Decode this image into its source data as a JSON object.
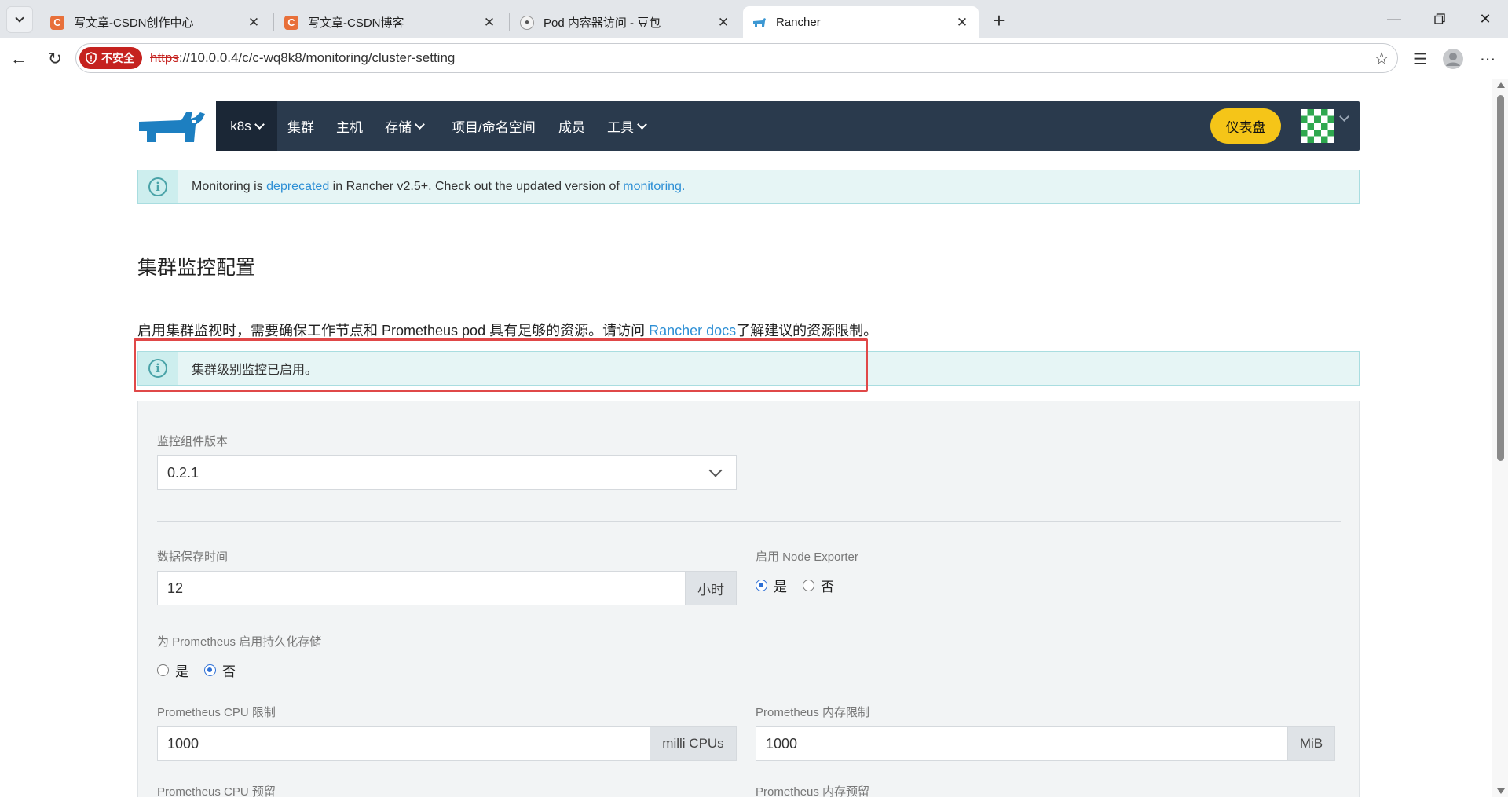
{
  "browser": {
    "tabs": [
      {
        "title": "写文章-CSDN创作中心",
        "favicon": "csdn-c-icon",
        "favicon_color": "#e8703a",
        "active": false
      },
      {
        "title": "写文章-CSDN博客",
        "favicon": "csdn-c-icon",
        "favicon_color": "#e8703a",
        "active": false
      },
      {
        "title": "Pod 内容器访问 - 豆包",
        "favicon": "doubao-avatar-icon",
        "favicon_color": "#555555",
        "active": false
      },
      {
        "title": "Rancher",
        "favicon": "rancher-icon",
        "favicon_color": "#3d98d3",
        "active": true
      }
    ],
    "security_label": "不安全",
    "url_scheme": "https",
    "url_rest": "://10.0.0.4/c/c-wq8k8/monitoring/cluster-setting"
  },
  "header": {
    "cluster": "k8s",
    "nav": [
      "集群",
      "主机",
      "存储",
      "项目/命名空间",
      "成员",
      "工具"
    ],
    "dashboard_button": "仪表盘",
    "accent_color": "#f5c518",
    "nav_bg": "#2a3a4d"
  },
  "deprecation_banner": {
    "prefix": "Monitoring is ",
    "link1": "deprecated",
    "middle": " in Rancher v2.5+. Check out the updated version of ",
    "link2": "monitoring."
  },
  "page": {
    "title": "集群监控配置",
    "desc_prefix": "启用集群监视时，需要确保工作节点和 Prometheus pod 具有足够的资源。请访问 ",
    "desc_link": "Rancher docs",
    "desc_suffix": "了解建议的资源限制。"
  },
  "status_banner": {
    "text": "集群级别监控已启用。"
  },
  "form": {
    "version_label": "监控组件版本",
    "version_value": "0.2.1",
    "retention_label": "数据保存时间",
    "retention_value": "12",
    "retention_unit": "小时",
    "node_exporter_label": "启用 Node Exporter",
    "node_exporter_yes": "是",
    "node_exporter_no": "否",
    "persist_label": "为 Prometheus 启用持久化存储",
    "persist_yes": "是",
    "persist_no": "否",
    "cpu_limit_label": "Prometheus CPU 限制",
    "cpu_limit_value": "1000",
    "cpu_limit_unit": "milli CPUs",
    "mem_limit_label": "Prometheus 内存限制",
    "mem_limit_value": "1000",
    "mem_limit_unit": "MiB",
    "cpu_reserve_label": "Prometheus CPU 预留",
    "mem_reserve_label": "Prometheus 内存预留"
  }
}
